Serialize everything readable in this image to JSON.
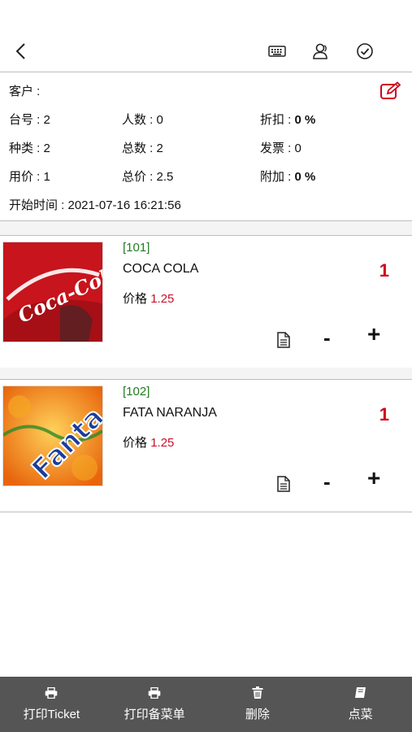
{
  "header": {
    "icons": [
      "back-arrow-icon",
      "keyboard-icon",
      "customer-icon",
      "check-circle-icon"
    ]
  },
  "order_info": {
    "customer": "客户 :",
    "table": "台号 : 2",
    "people": "人数 : 0",
    "discount_label": "折扣 : ",
    "discount_value": "0 %",
    "category": "种类 : 2",
    "total_count": "总数 : 2",
    "invoice": "发票 : 0",
    "price_used": "用价 : 1",
    "total_price": "总价 : 2.5",
    "extra_label": "附加 : ",
    "extra_value": "0 %",
    "start_time": "开始时间 : 2021-07-16 16:21:56"
  },
  "items": [
    {
      "code": "[101]",
      "name": "COCA COLA",
      "price_label": "价格",
      "price": "1.25",
      "qty": "1",
      "logo_text": "Coca-Cola"
    },
    {
      "code": "[102]",
      "name": "FATA NARANJA",
      "price_label": "价格",
      "price": "1.25",
      "qty": "1",
      "logo_text": "Fanta"
    }
  ],
  "controls": {
    "minus": "-",
    "plus": "+"
  },
  "bottom_tabs": [
    {
      "label": "打印Ticket",
      "icon": "printer-icon"
    },
    {
      "label": "打印备菜单",
      "icon": "printer-icon"
    },
    {
      "label": "删除",
      "icon": "trash-icon"
    },
    {
      "label": "点菜",
      "icon": "book-icon"
    }
  ],
  "colors": {
    "accent_red": "#d0021b",
    "code_green": "#1e7d1e",
    "bottom_bar": "#555555"
  }
}
